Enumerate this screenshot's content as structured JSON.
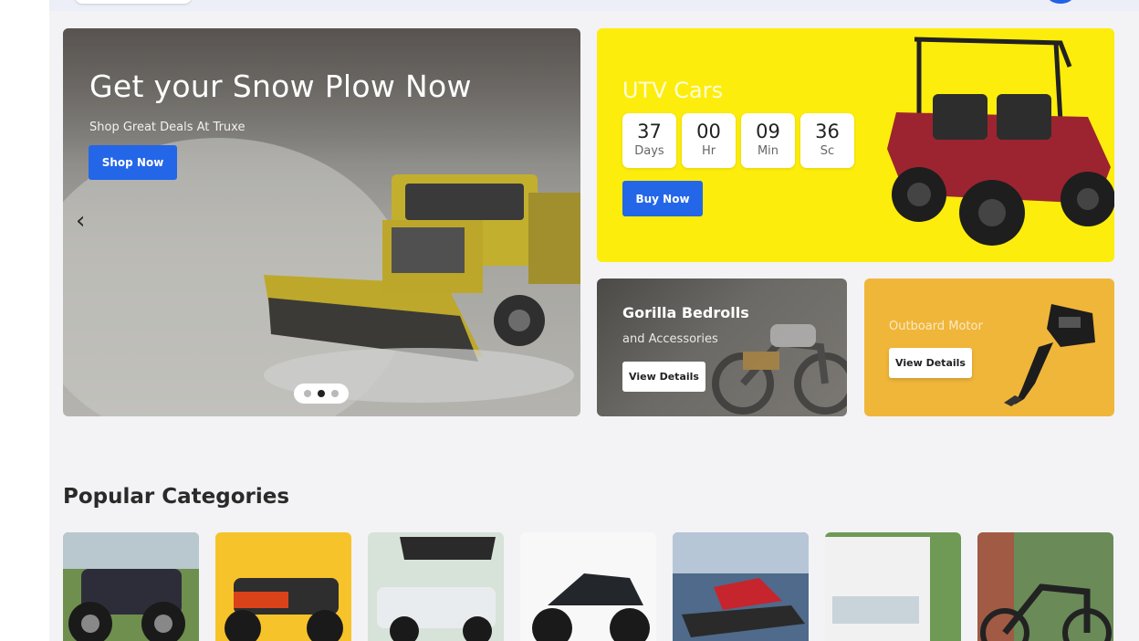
{
  "hero": {
    "title": "Get your Snow Plow Now",
    "subtitle": "Shop Great Deals At Truxe",
    "button": "Shop Now",
    "prev_icon": "chevron-left-icon",
    "slides": 3,
    "active_slide": 2
  },
  "utv": {
    "title": "UTV Cars",
    "countdown": [
      {
        "value": "37",
        "unit": "Days"
      },
      {
        "value": "00",
        "unit": "Hr"
      },
      {
        "value": "09",
        "unit": "Min"
      },
      {
        "value": "36",
        "unit": "Sc"
      }
    ],
    "button": "Buy Now"
  },
  "gorilla": {
    "title": "Gorilla Bedrolls",
    "subtitle": "and Accessories",
    "button": "View Details"
  },
  "outboard": {
    "title": "Outboard Motor",
    "button": "View Details"
  },
  "categories": {
    "title": "Popular Categories",
    "items": [
      "atv",
      "quad",
      "golf-cart",
      "motorcycle",
      "jet-ski",
      "food-truck",
      "e-bike"
    ]
  },
  "colors": {
    "accent": "#2466e8",
    "utv_bg": "#fded0c",
    "outboard_bg": "#f0b63a"
  }
}
